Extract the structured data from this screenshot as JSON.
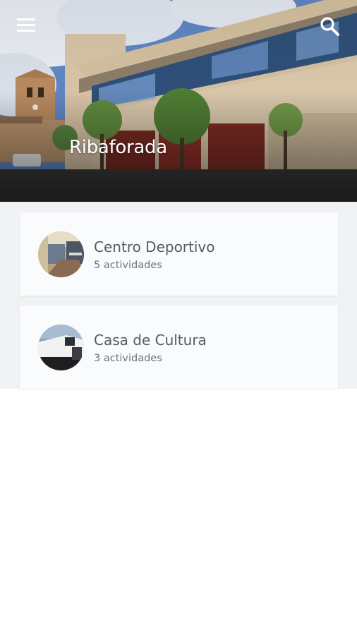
{
  "header": {
    "title": "Ribaforada",
    "menu_icon": "hamburger-menu-icon",
    "search_icon": "search-icon"
  },
  "venues": [
    {
      "name": "Centro Deportivo",
      "activities": "5 actividades",
      "image": "sports-center-photo"
    },
    {
      "name": "Casa de Cultura",
      "activities": "3 actividades",
      "image": "culture-house-photo"
    }
  ],
  "colors": {
    "list_background": "#f1f2f4",
    "card_background": "#fafbfc",
    "title_text": "#545b63",
    "subtitle_text": "#6d737a"
  }
}
